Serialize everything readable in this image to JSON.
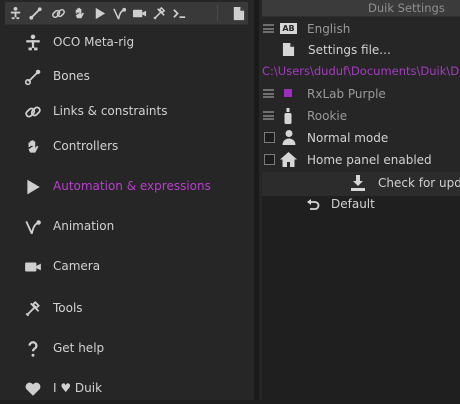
{
  "left_panel": {
    "toolbar_icons": [
      "rig-icon",
      "bone-icon",
      "link-icon",
      "hand-icon",
      "play-icon",
      "animation-icon",
      "camera-icon",
      "tools-icon",
      "expression-icon",
      "document-icon"
    ],
    "menu": [
      {
        "label": "OCO Meta-rig",
        "icon": "meta-rig-icon"
      },
      {
        "label": "Bones",
        "icon": "bone-icon"
      },
      {
        "label": "Links & constraints",
        "icon": "link-icon"
      },
      {
        "label": "Controllers",
        "icon": "hand-icon"
      },
      {
        "label": "Automation & expressions",
        "icon": "play-icon",
        "active": true
      },
      {
        "label": "Animation",
        "icon": "animation-icon"
      },
      {
        "label": "Camera",
        "icon": "camera-icon"
      },
      {
        "label": "Tools",
        "icon": "tools-icon"
      },
      {
        "label": "Get help",
        "icon": "question-icon"
      },
      {
        "label": "I ♥ Duik",
        "icon": "heart-icon"
      }
    ]
  },
  "settings": {
    "title": "Duik Settings",
    "language": "English",
    "settings_file": "Settings file...",
    "path": "C:\\Users\\duduf\\Documents\\Duik\\Duik_s",
    "color_theme": "RxLab Purple",
    "mode": "Rookie",
    "normal_mode": "Normal mode",
    "home_panel": "Home panel enabled",
    "check_updates": "Check for update",
    "default": "Default"
  },
  "colors": {
    "accent": "#b93ed0",
    "path": "#a63bc4",
    "swatch": "#9a2fc0"
  }
}
